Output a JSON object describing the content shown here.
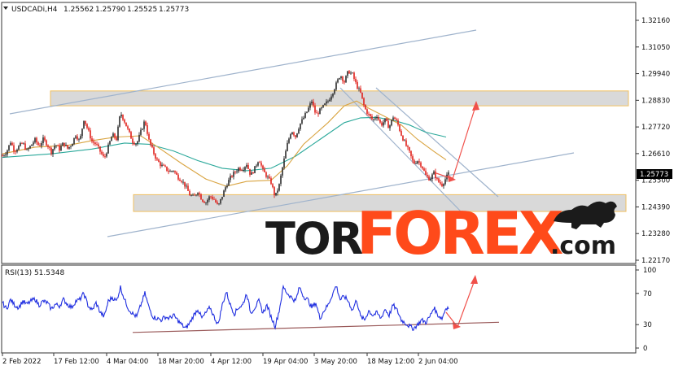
{
  "chart_data": [
    {
      "type": "candlestick",
      "title": "USDCADi,H4",
      "ohlc": {
        "open": "1.25562",
        "high": "1.25790",
        "low": "1.25525",
        "close": "1.25773"
      },
      "current_price_label": "1.25773",
      "y_ticks": [
        "1.32160",
        "1.31050",
        "1.29940",
        "1.28830",
        "1.27720",
        "1.26610",
        "1.25500",
        "1.24390",
        "1.23280",
        "1.22170"
      ],
      "x_ticks": [
        "2 Feb 2022",
        "17 Feb 12:00",
        "4 Mar 04:00",
        "18 Mar 20:00",
        "4 Apr 12:00",
        "19 Apr 04:00",
        "3 May 20:00",
        "18 May 12:00",
        "2 Jun 04:00"
      ],
      "ylim": [
        1.2217,
        1.3216
      ],
      "up_color": "#2b2b2b",
      "down_color": "#e0201a",
      "ma_fast_color": "#d9a441",
      "ma_slow_color": "#2aa89a",
      "channel_color": "#9fb3cc",
      "resistance_zone": [
        1.286,
        1.2922
      ],
      "support_zone": [
        1.242,
        1.249
      ],
      "close_path": [
        [
          0,
          1.2652
        ],
        [
          5,
          1.2668
        ],
        [
          10,
          1.271
        ],
        [
          15,
          1.2672
        ],
        [
          20,
          1.269
        ],
        [
          25,
          1.2705
        ],
        [
          30,
          1.2672
        ],
        [
          35,
          1.2695
        ],
        [
          40,
          1.2718
        ],
        [
          45,
          1.2692
        ],
        [
          50,
          1.272
        ],
        [
          55,
          1.27
        ],
        [
          60,
          1.2668
        ],
        [
          65,
          1.27
        ],
        [
          70,
          1.268
        ],
        [
          75,
          1.2705
        ],
        [
          80,
          1.2682
        ],
        [
          85,
          1.27
        ],
        [
          90,
          1.274
        ],
        [
          95,
          1.2712
        ],
        [
          100,
          1.2805
        ],
        [
          105,
          1.276
        ],
        [
          110,
          1.2712
        ],
        [
          115,
          1.27
        ],
        [
          120,
          1.267
        ],
        [
          125,
          1.264
        ],
        [
          130,
          1.269
        ],
        [
          135,
          1.274
        ],
        [
          140,
          1.2722
        ],
        [
          145,
          1.2832
        ],
        [
          150,
          1.2795
        ],
        [
          155,
          1.2752
        ],
        [
          160,
          1.2712
        ],
        [
          165,
          1.2702
        ],
        [
          170,
          1.2752
        ],
        [
          175,
          1.28
        ],
        [
          180,
          1.2715
        ],
        [
          185,
          1.267
        ],
        [
          190,
          1.2632
        ],
        [
          195,
          1.2612
        ],
        [
          200,
          1.26
        ],
        [
          205,
          1.2585
        ],
        [
          210,
          1.2592
        ],
        [
          215,
          1.2565
        ],
        [
          220,
          1.255
        ],
        [
          225,
          1.2525
        ],
        [
          230,
          1.249
        ],
        [
          235,
          1.2478
        ],
        [
          240,
          1.2505
        ],
        [
          245,
          1.247
        ],
        [
          250,
          1.2458
        ],
        [
          255,
          1.2485
        ],
        [
          260,
          1.247
        ],
        [
          265,
          1.244
        ],
        [
          270,
          1.2485
        ],
        [
          275,
          1.253
        ],
        [
          280,
          1.256
        ],
        [
          285,
          1.2582
        ],
        [
          290,
          1.26
        ],
        [
          295,
          1.2598
        ],
        [
          300,
          1.2618
        ],
        [
          305,
          1.257
        ],
        [
          310,
          1.26
        ],
        [
          315,
          1.264
        ],
        [
          320,
          1.259
        ],
        [
          325,
          1.2565
        ],
        [
          330,
          1.254
        ],
        [
          335,
          1.248
        ],
        [
          340,
          1.253
        ],
        [
          345,
          1.262
        ],
        [
          350,
          1.27
        ],
        [
          355,
          1.276
        ],
        [
          360,
          1.2732
        ],
        [
          365,
          1.278
        ],
        [
          370,
          1.281
        ],
        [
          375,
          1.2842
        ],
        [
          380,
          1.288
        ],
        [
          385,
          1.2822
        ],
        [
          390,
          1.284
        ],
        [
          395,
          1.286
        ],
        [
          400,
          1.288
        ],
        [
          405,
          1.2912
        ],
        [
          410,
          1.295
        ],
        [
          415,
          1.299
        ],
        [
          420,
          1.296
        ],
        [
          425,
          1.3005
        ],
        [
          430,
          1.299
        ],
        [
          435,
          1.2945
        ],
        [
          440,
          1.2912
        ],
        [
          445,
          1.285
        ],
        [
          450,
          1.2822
        ],
        [
          455,
          1.28
        ],
        [
          460,
          1.282
        ],
        [
          465,
          1.278
        ],
        [
          470,
          1.28
        ],
        [
          475,
          1.277
        ],
        [
          480,
          1.2815
        ],
        [
          485,
          1.279
        ],
        [
          490,
          1.274
        ],
        [
          495,
          1.27
        ],
        [
          500,
          1.2665
        ],
        [
          505,
          1.262
        ],
        [
          510,
          1.2632
        ],
        [
          515,
          1.2612
        ],
        [
          520,
          1.257
        ],
        [
          525,
          1.2555
        ],
        [
          530,
          1.258
        ],
        [
          535,
          1.2545
        ],
        [
          540,
          1.2532
        ],
        [
          545,
          1.256
        ],
        [
          548,
          1.2577
        ]
      ],
      "ma_fast": [
        [
          0,
          1.266
        ],
        [
          40,
          1.2688
        ],
        [
          80,
          1.2695
        ],
        [
          110,
          1.2715
        ],
        [
          140,
          1.273
        ],
        [
          170,
          1.2735
        ],
        [
          190,
          1.269
        ],
        [
          220,
          1.262
        ],
        [
          250,
          1.2555
        ],
        [
          275,
          1.2525
        ],
        [
          300,
          1.2545
        ],
        [
          330,
          1.255
        ],
        [
          350,
          1.261
        ],
        [
          370,
          1.27
        ],
        [
          400,
          1.279
        ],
        [
          420,
          1.286
        ],
        [
          435,
          1.288
        ],
        [
          450,
          1.285
        ],
        [
          470,
          1.2815
        ],
        [
          490,
          1.278
        ],
        [
          510,
          1.272
        ],
        [
          530,
          1.267
        ],
        [
          545,
          1.2635
        ]
      ],
      "ma_slow": [
        [
          0,
          1.2645
        ],
        [
          60,
          1.266
        ],
        [
          110,
          1.268
        ],
        [
          150,
          1.2705
        ],
        [
          180,
          1.27
        ],
        [
          210,
          1.2672
        ],
        [
          240,
          1.2632
        ],
        [
          270,
          1.26
        ],
        [
          300,
          1.259
        ],
        [
          330,
          1.26
        ],
        [
          360,
          1.265
        ],
        [
          390,
          1.272
        ],
        [
          420,
          1.279
        ],
        [
          440,
          1.281
        ],
        [
          460,
          1.2812
        ],
        [
          480,
          1.28
        ],
        [
          500,
          1.278
        ],
        [
          520,
          1.275
        ],
        [
          545,
          1.273
        ]
      ]
    },
    {
      "type": "line",
      "title": "RSI(13) 51.5348",
      "y_ticks": [
        "100",
        "70",
        "30",
        "0"
      ],
      "ylim": [
        0,
        100
      ],
      "line_color": "#1f2ee0",
      "trendline_color": "#9a5a5a",
      "values": [
        [
          0,
          58
        ],
        [
          5,
          50
        ],
        [
          10,
          62
        ],
        [
          15,
          55
        ],
        [
          20,
          52
        ],
        [
          25,
          60
        ],
        [
          30,
          56
        ],
        [
          35,
          60
        ],
        [
          40,
          63
        ],
        [
          45,
          55
        ],
        [
          50,
          60
        ],
        [
          55,
          58
        ],
        [
          60,
          50
        ],
        [
          65,
          56
        ],
        [
          70,
          54
        ],
        [
          75,
          62
        ],
        [
          80,
          56
        ],
        [
          85,
          52
        ],
        [
          90,
          60
        ],
        [
          95,
          62
        ],
        [
          100,
          70
        ],
        [
          105,
          55
        ],
        [
          110,
          48
        ],
        [
          115,
          58
        ],
        [
          120,
          46
        ],
        [
          125,
          40
        ],
        [
          130,
          60
        ],
        [
          135,
          65
        ],
        [
          140,
          60
        ],
        [
          145,
          78
        ],
        [
          150,
          62
        ],
        [
          155,
          50
        ],
        [
          160,
          44
        ],
        [
          165,
          40
        ],
        [
          170,
          55
        ],
        [
          175,
          70
        ],
        [
          180,
          52
        ],
        [
          185,
          40
        ],
        [
          190,
          38
        ],
        [
          195,
          36
        ],
        [
          200,
          40
        ],
        [
          205,
          38
        ],
        [
          210,
          42
        ],
        [
          215,
          36
        ],
        [
          220,
          30
        ],
        [
          225,
          25
        ],
        [
          230,
          32
        ],
        [
          235,
          42
        ],
        [
          240,
          50
        ],
        [
          245,
          38
        ],
        [
          250,
          45
        ],
        [
          255,
          52
        ],
        [
          260,
          40
        ],
        [
          265,
          30
        ],
        [
          270,
          55
        ],
        [
          275,
          72
        ],
        [
          280,
          55
        ],
        [
          285,
          44
        ],
        [
          290,
          52
        ],
        [
          295,
          55
        ],
        [
          300,
          70
        ],
        [
          305,
          45
        ],
        [
          310,
          52
        ],
        [
          315,
          60
        ],
        [
          320,
          45
        ],
        [
          325,
          55
        ],
        [
          330,
          40
        ],
        [
          335,
          28
        ],
        [
          340,
          48
        ],
        [
          345,
          78
        ],
        [
          350,
          70
        ],
        [
          355,
          65
        ],
        [
          360,
          60
        ],
        [
          365,
          78
        ],
        [
          370,
          66
        ],
        [
          375,
          62
        ],
        [
          380,
          52
        ],
        [
          385,
          58
        ],
        [
          390,
          38
        ],
        [
          395,
          48
        ],
        [
          400,
          55
        ],
        [
          405,
          68
        ],
        [
          410,
          80
        ],
        [
          415,
          62
        ],
        [
          420,
          66
        ],
        [
          425,
          60
        ],
        [
          430,
          48
        ],
        [
          435,
          62
        ],
        [
          440,
          40
        ],
        [
          445,
          36
        ],
        [
          450,
          48
        ],
        [
          455,
          42
        ],
        [
          460,
          45
        ],
        [
          465,
          38
        ],
        [
          470,
          50
        ],
        [
          475,
          42
        ],
        [
          480,
          55
        ],
        [
          485,
          48
        ],
        [
          490,
          36
        ],
        [
          495,
          32
        ],
        [
          500,
          28
        ],
        [
          505,
          25
        ],
        [
          510,
          30
        ],
        [
          515,
          36
        ],
        [
          520,
          33
        ],
        [
          525,
          40
        ],
        [
          530,
          52
        ],
        [
          535,
          42
        ],
        [
          540,
          38
        ],
        [
          545,
          52
        ],
        [
          548,
          51.5
        ]
      ],
      "trendline": [
        [
          160,
          20
        ],
        [
          610,
          33
        ]
      ]
    }
  ],
  "watermark": {
    "part1": "TOR",
    "part2": "FOREX",
    "part3": ".com",
    "color1": "#1b1b1b",
    "color2": "#ff4a1a",
    "color3": "#1b1b1b"
  }
}
